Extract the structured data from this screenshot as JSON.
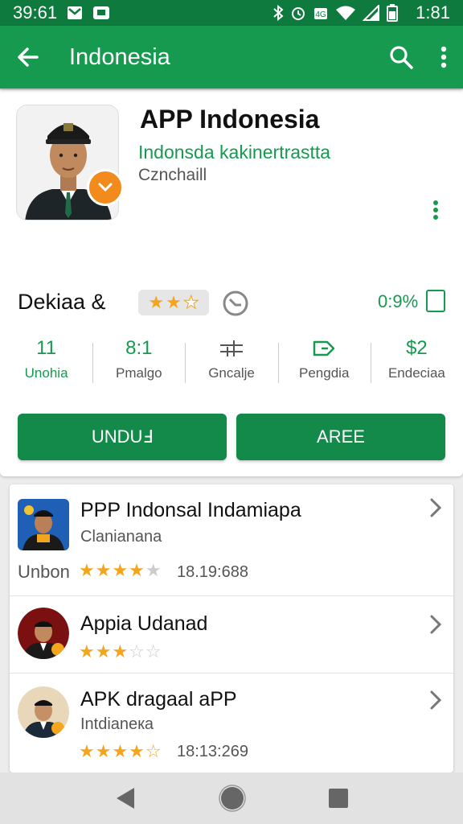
{
  "status": {
    "time_left": "39:61",
    "time_right": "1:81"
  },
  "appbar": {
    "title": "Indonesia"
  },
  "app": {
    "title": "APP Indonesia",
    "developer": "Indonsda kakinertrastta",
    "category": "Cznchaill"
  },
  "section": {
    "title": "Dekiaa &",
    "right_value": "0:9%"
  },
  "stats": [
    {
      "value": "11",
      "label": "Unohia"
    },
    {
      "value": "8:1",
      "label": "Pmalgo"
    },
    {
      "value": "",
      "label": "Gncalje"
    },
    {
      "value": "",
      "label": "Pengdia"
    },
    {
      "value": "$2",
      "label": "Endeciaa"
    }
  ],
  "buttons": {
    "primary": "UNDUℲ",
    "secondary": "AREE"
  },
  "list": [
    {
      "title": "PPP Indonsal Indamiapa",
      "subtitle": "Clanianana",
      "prefix": "Unbon",
      "rating": 4,
      "meta": "18.19:688"
    },
    {
      "title": "Appia Udanad",
      "subtitle": "",
      "prefix": "",
      "rating": 3,
      "meta": ""
    },
    {
      "title": "APK dragaal aPP",
      "subtitle": "Intdianeкa",
      "prefix": "",
      "rating": 4.5,
      "meta": "18:13:269"
    }
  ],
  "colors": {
    "accent": "#169a4f",
    "status_bar": "#0f7a3e",
    "star": "#f3a51e",
    "badge": "#f28a1c"
  },
  "icons": [
    "arrow-back-icon",
    "search-icon",
    "more-vert-icon",
    "clock-icon",
    "checkbox-icon",
    "chevron-right-icon",
    "back-nav-icon",
    "home-nav-icon",
    "recents-nav-icon"
  ]
}
